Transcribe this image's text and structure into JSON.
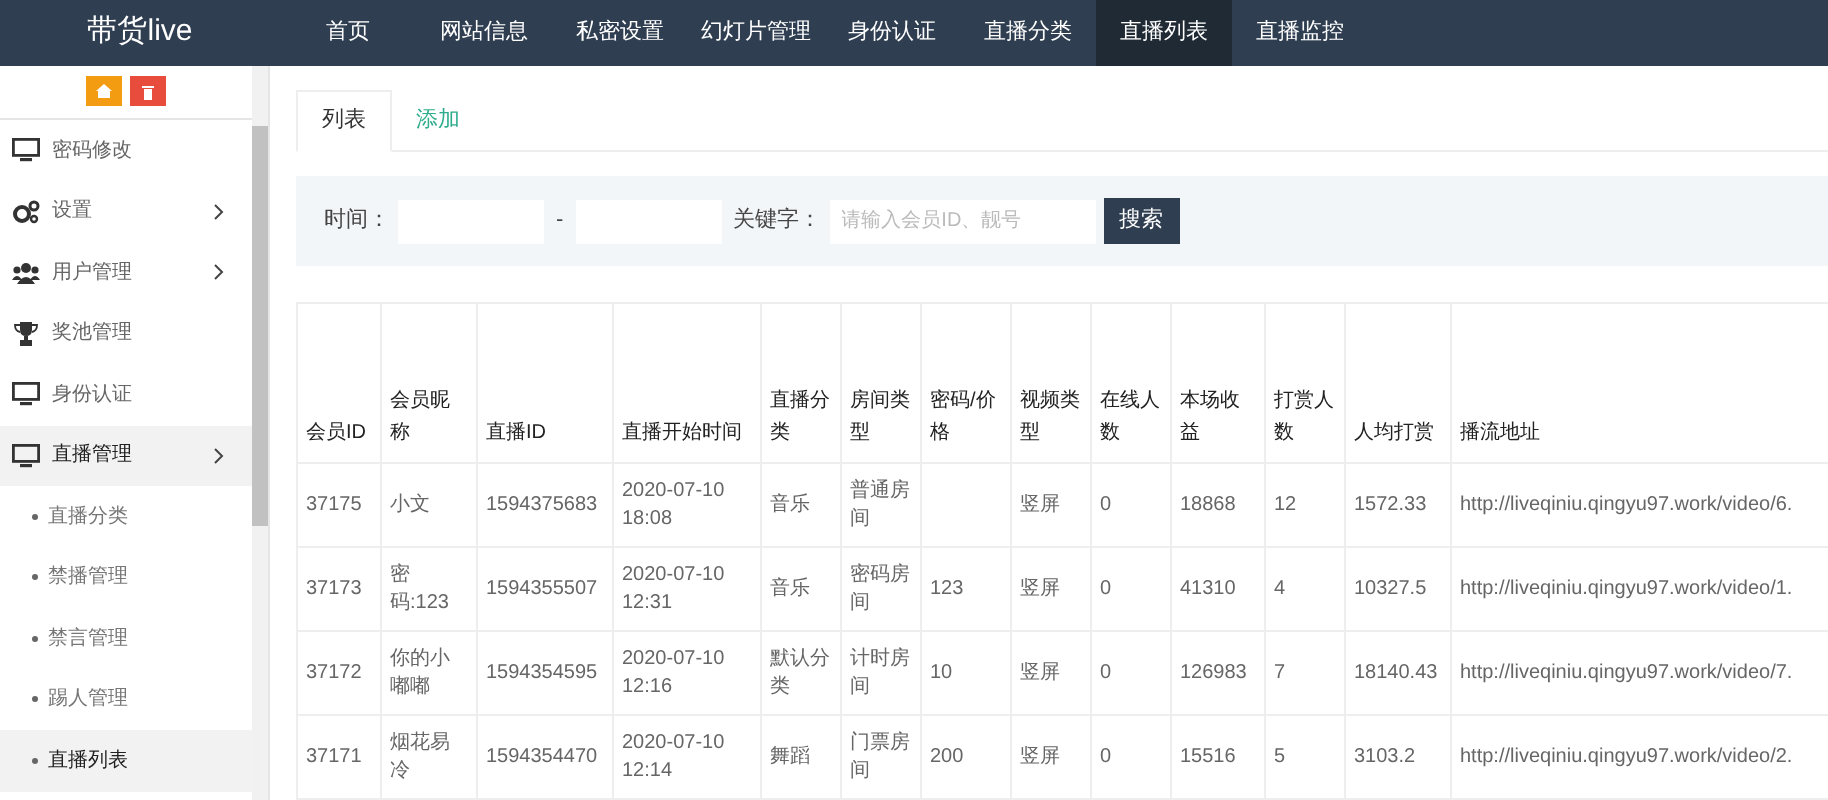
{
  "brand": "带货live",
  "nav": [
    {
      "label": "首页",
      "selected": false
    },
    {
      "label": "网站信息",
      "selected": false
    },
    {
      "label": "私密设置",
      "selected": false
    },
    {
      "label": "幻灯片管理",
      "selected": false
    },
    {
      "label": "身份认证",
      "selected": false
    },
    {
      "label": "直播分类",
      "selected": false
    },
    {
      "label": "直播列表",
      "selected": true
    },
    {
      "label": "直播监控",
      "selected": false
    }
  ],
  "sidebar": {
    "items": [
      {
        "label": "密码修改",
        "expanded": false,
        "has_arrow": false
      },
      {
        "label": "设置",
        "expanded": false,
        "has_arrow": true
      },
      {
        "label": "用户管理",
        "expanded": false,
        "has_arrow": true
      },
      {
        "label": "奖池管理",
        "expanded": false,
        "has_arrow": false
      },
      {
        "label": "身份认证",
        "expanded": false,
        "has_arrow": false
      },
      {
        "label": "直播管理",
        "expanded": true,
        "has_arrow": true,
        "children": [
          {
            "label": "直播分类",
            "selected": false
          },
          {
            "label": "禁播管理",
            "selected": false
          },
          {
            "label": "禁言管理",
            "selected": false
          },
          {
            "label": "踢人管理",
            "selected": false
          },
          {
            "label": "直播列表",
            "selected": true
          }
        ]
      }
    ]
  },
  "tabs": [
    {
      "label": "列表",
      "selected": true
    },
    {
      "label": "添加",
      "selected": false
    }
  ],
  "search": {
    "time_label": "时间：",
    "separator": "-",
    "keyword_label": "关键字：",
    "placeholder": "请输入会员ID、靓号",
    "button": "搜索"
  },
  "table": {
    "columns": [
      "会员ID",
      "会员昵称",
      "直播ID",
      "直播开始时间",
      "直播分类",
      "房间类型",
      "密码/价格",
      "视频类型",
      "在线人数",
      "本场收益",
      "打赏人数",
      "人均打赏",
      "播流地址"
    ],
    "rows": [
      [
        "37175",
        "小文",
        "1594375683",
        "2020-07-10 18:08",
        "音乐",
        "普通房间",
        "",
        "竖屏",
        "0",
        "18868",
        "12",
        "1572.33",
        "http://liveqiniu.qingyu97.work/video/6."
      ],
      [
        "37173",
        "密码:123",
        "1594355507",
        "2020-07-10 12:31",
        "音乐",
        "密码房间",
        "123",
        "竖屏",
        "0",
        "41310",
        "4",
        "10327.5",
        "http://liveqiniu.qingyu97.work/video/1."
      ],
      [
        "37172",
        "你的小嘟嘟",
        "1594354595",
        "2020-07-10 12:16",
        "默认分类",
        "计时房间",
        "10",
        "竖屏",
        "0",
        "126983",
        "7",
        "18140.43",
        "http://liveqiniu.qingyu97.work/video/7."
      ],
      [
        "37171",
        "烟花易冷",
        "1594354470",
        "2020-07-10 12:14",
        "舞蹈",
        "门票房间",
        "200",
        "竖屏",
        "0",
        "15516",
        "5",
        "3103.2",
        "http://liveqiniu.qingyu97.work/video/2."
      ]
    ]
  }
}
